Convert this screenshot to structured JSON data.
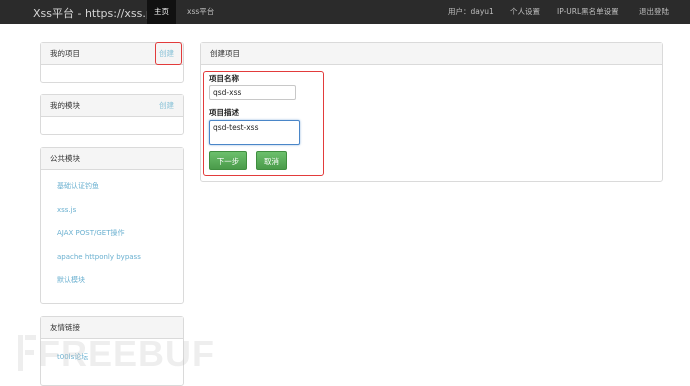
{
  "navbar": {
    "brand": "Xss平台 - https://xss.pt",
    "home": "主页",
    "xss_platform": "xss平台",
    "user": "用户：dayu1",
    "settings": "个人设置",
    "blacklist": "IP-URL黑名单设置",
    "logout": "退出登陆"
  },
  "sidebar": {
    "my_projects": {
      "title": "我的项目",
      "action": "创建"
    },
    "my_modules": {
      "title": "我的模块",
      "action": "创建"
    },
    "public_modules": {
      "title": "公共模块",
      "items": [
        "基础认证钓鱼",
        "xss.js",
        "AJAX POST/GET操作",
        "apache httponly bypass",
        "默认模块"
      ]
    },
    "friend_links": {
      "title": "友情链接",
      "items": [
        "t00ls论坛"
      ]
    }
  },
  "create_project": {
    "title": "创建项目",
    "name_label": "项目名称",
    "name_value": "qsd-xss",
    "desc_label": "项目描述",
    "desc_value": "qsd-test-xss",
    "next_button": "下一步",
    "cancel_button": "取消"
  },
  "watermark": "FREEBUF",
  "colors": {
    "navbar": "#2b2b2b",
    "link": "#6ab0d0",
    "button": "#4a9b4a",
    "highlight": "#e23b3b"
  }
}
